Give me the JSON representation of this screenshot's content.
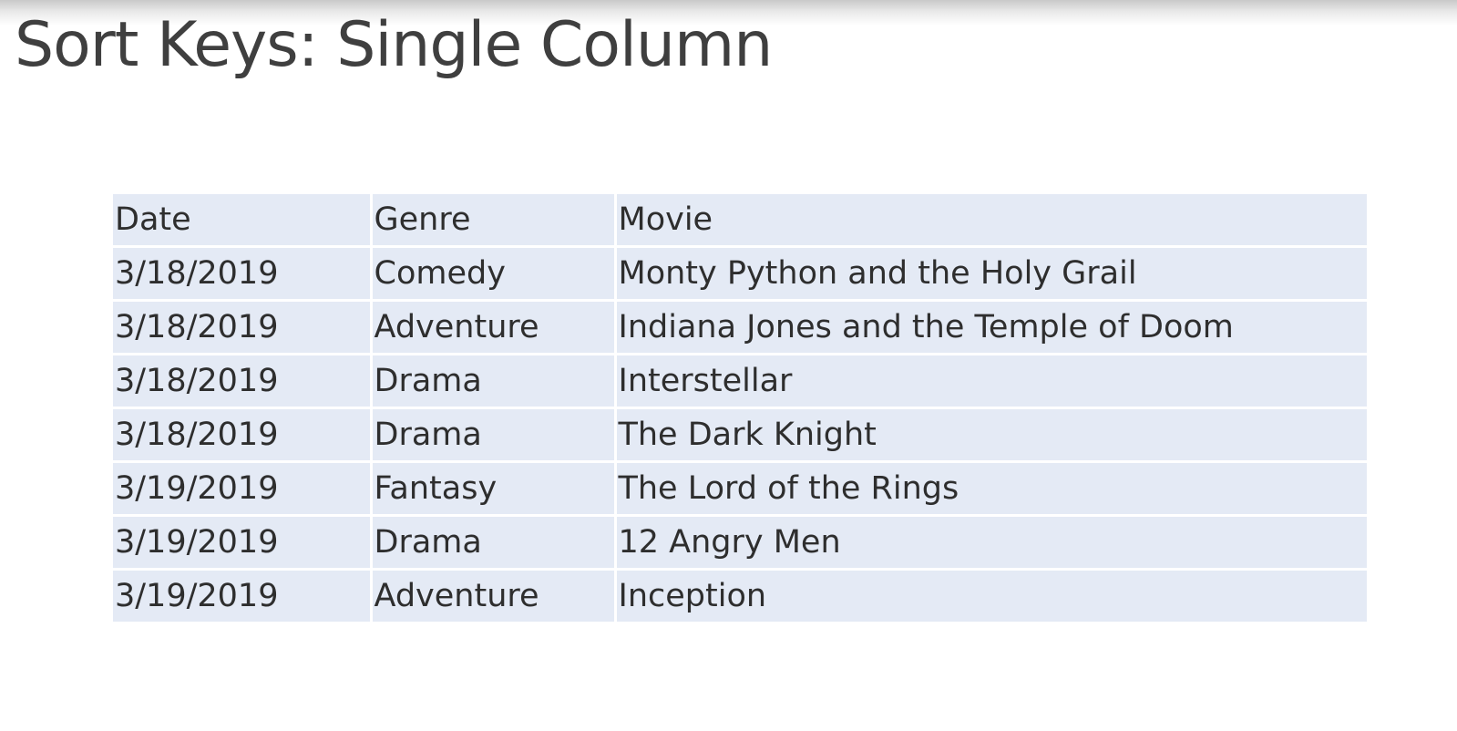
{
  "slide": {
    "title": "Sort Keys: Single Column"
  },
  "table": {
    "headers": [
      "Date",
      "Genre",
      "Movie"
    ],
    "rows": [
      [
        "3/18/2019",
        "Comedy",
        "Monty Python and the Holy Grail"
      ],
      [
        "3/18/2019",
        "Adventure",
        "Indiana Jones and the Temple of Doom"
      ],
      [
        "3/18/2019",
        "Drama",
        "Interstellar"
      ],
      [
        "3/18/2019",
        "Drama",
        "The Dark Knight"
      ],
      [
        "3/19/2019",
        "Fantasy",
        "The Lord of the Rings"
      ],
      [
        "3/19/2019",
        "Drama",
        "12 Angry Men"
      ],
      [
        "3/19/2019",
        "Adventure",
        "Inception"
      ]
    ]
  },
  "colors": {
    "cell_background": "#e4eaf5",
    "title_text": "#3f3f3f"
  }
}
